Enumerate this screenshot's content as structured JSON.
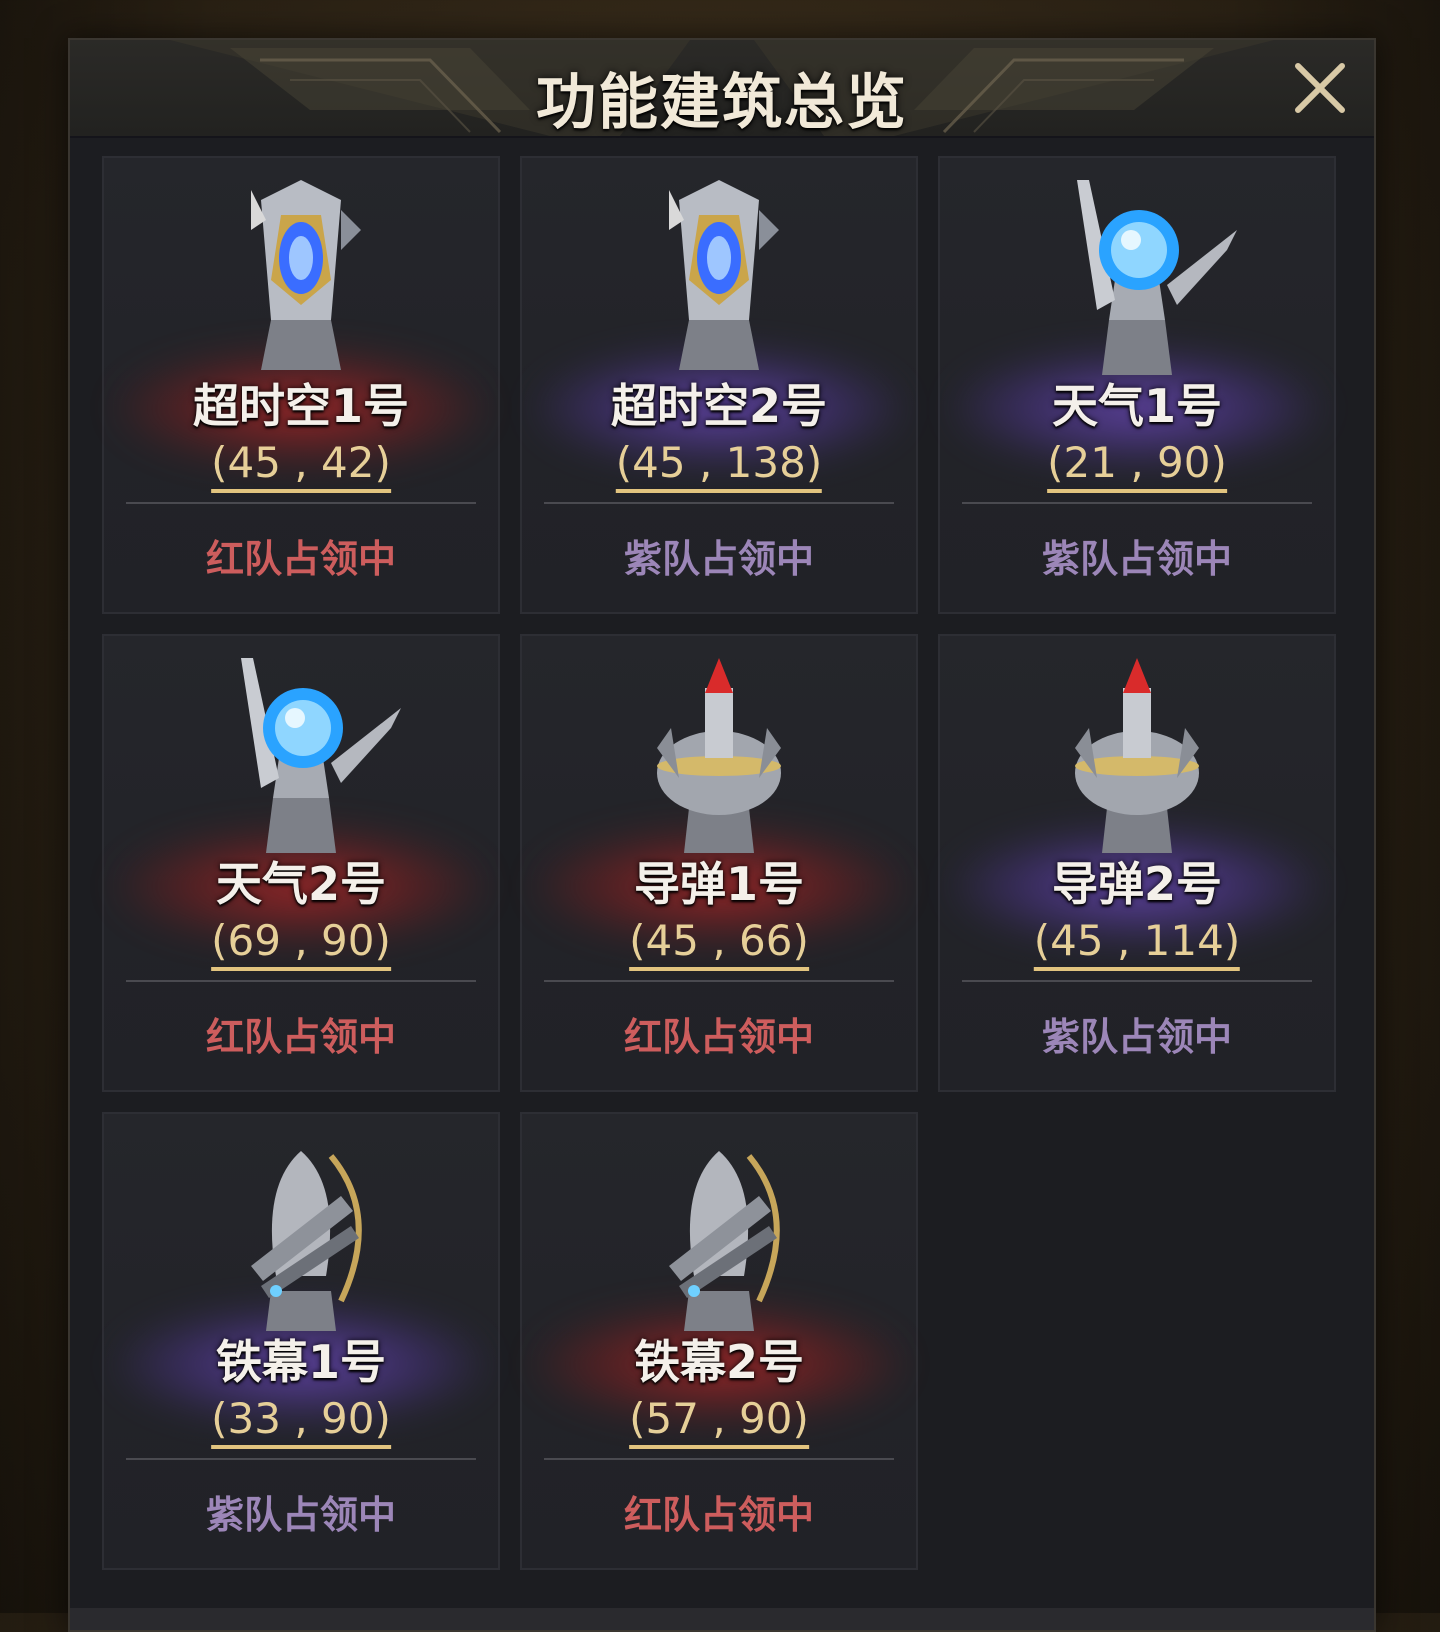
{
  "window": {
    "title": "功能建筑总览",
    "close_icon": "close-icon"
  },
  "colors": {
    "red_team": "#cd5d5d",
    "purple_team": "#9c86b8",
    "coord": "#e6cf98",
    "accent_gold": "#e2c47f"
  },
  "buildings": [
    {
      "name": "超时空1号",
      "coord": "(45 , 42)",
      "status": "红队占领中",
      "team": "red",
      "icon": "chronosphere-tower-icon"
    },
    {
      "name": "超时空2号",
      "coord": "(45 , 138)",
      "status": "紫队占领中",
      "team": "purple",
      "icon": "chronosphere-tower-icon"
    },
    {
      "name": "天气1号",
      "coord": "(21 , 90)",
      "status": "紫队占领中",
      "team": "purple",
      "icon": "weather-tower-icon"
    },
    {
      "name": "天气2号",
      "coord": "(69 , 90)",
      "status": "红队占领中",
      "team": "red",
      "icon": "weather-tower-icon"
    },
    {
      "name": "导弹1号",
      "coord": "(45 , 66)",
      "status": "红队占领中",
      "team": "red",
      "icon": "missile-tower-icon"
    },
    {
      "name": "导弹2号",
      "coord": "(45 , 114)",
      "status": "紫队占领中",
      "team": "purple",
      "icon": "missile-tower-icon"
    },
    {
      "name": "铁幕1号",
      "coord": "(33 , 90)",
      "status": "紫队占领中",
      "team": "purple",
      "icon": "iron-curtain-tower-icon"
    },
    {
      "name": "铁幕2号",
      "coord": "(57 , 90)",
      "status": "红队占领中",
      "team": "red",
      "icon": "iron-curtain-tower-icon"
    }
  ]
}
